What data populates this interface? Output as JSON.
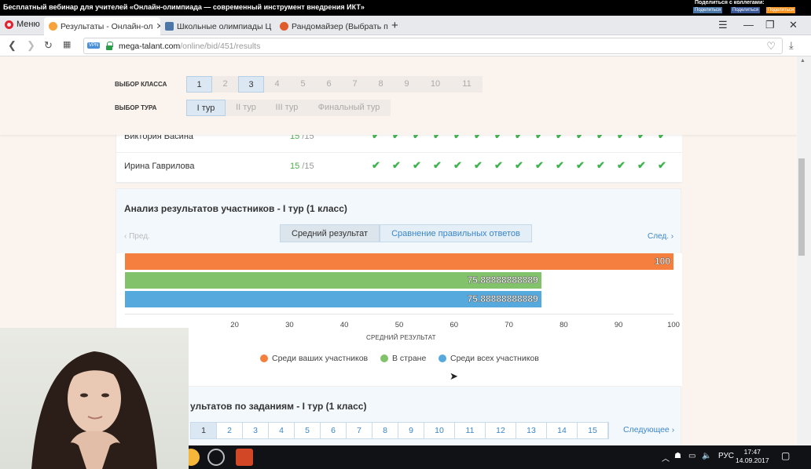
{
  "window": {
    "title": "Бесплатный вебинар для учителей «Онлайн-олимпиада — современный инструмент внедрения ИКТ»",
    "share_title": "Поделиться с коллегами:",
    "share_buttons": [
      "Поделиться",
      "Поделиться",
      "Поделиться"
    ]
  },
  "browser": {
    "menu_label": "Меню",
    "tabs": [
      {
        "label": "Результаты - Онлайн-ол",
        "active": true
      },
      {
        "label": "Школьные олимпиады Ц",
        "active": false
      },
      {
        "label": "Рандомайзер (Выбрать п",
        "active": false
      }
    ],
    "vpn_label": "VPN",
    "url_host": "mega-talant.com",
    "url_path": "/online/bid/451/results"
  },
  "filters": {
    "class_label": "ВЫБОР КЛАССА",
    "classes": [
      "1",
      "2",
      "3",
      "4",
      "5",
      "6",
      "7",
      "8",
      "9",
      "10",
      "11"
    ],
    "selected_class": "1",
    "tour_label": "ВЫБОР ТУРА",
    "tours": [
      "I тур",
      "II тур",
      "III тур",
      "Финальный тур"
    ],
    "selected_tour": "I тур"
  },
  "participants": [
    {
      "name": "Виктория Васина",
      "score": "15",
      "total": "/15",
      "checks": 15
    },
    {
      "name": "Ирина Гаврилова",
      "score": "15",
      "total": "/15",
      "checks": 15
    }
  ],
  "analysis": {
    "title": "Анализ результатов участников - I тур (1 класс)",
    "prev": "‹ Пред.",
    "next": "След. ›",
    "toggle": [
      "Средний результат",
      "Сравнение правильных ответов"
    ],
    "selected_toggle": "Средний результат"
  },
  "chart_data": {
    "type": "bar",
    "orientation": "horizontal",
    "series": [
      {
        "name": "Среди ваших участников",
        "value": 100,
        "label": "100",
        "color": "#f47f3f"
      },
      {
        "name": "В стране",
        "value": 75.88888888889,
        "label": "75.88888888889",
        "color": "#82c26a"
      },
      {
        "name": "Среди всех участников",
        "value": 75.88888888889,
        "label": "75.88888888889",
        "color": "#55a9dc"
      }
    ],
    "xlabel": "СРЕДНИЙ РЕЗУЛЬТАТ",
    "xlim": [
      0,
      100
    ],
    "ticks": [
      "20",
      "30",
      "40",
      "50",
      "60",
      "70",
      "80",
      "90",
      "100"
    ],
    "tick_values": [
      20,
      30,
      40,
      50,
      60,
      70,
      80,
      90,
      100
    ]
  },
  "tasks": {
    "title": "ультатов по заданиям - I тур (1 класс)",
    "pages": [
      "1",
      "2",
      "3",
      "4",
      "5",
      "6",
      "7",
      "8",
      "9",
      "10",
      "11",
      "12",
      "13",
      "14",
      "15"
    ],
    "selected_page": "1",
    "next": "Следующее ›"
  },
  "taskbar": {
    "lang": "РУС",
    "time": "17:47",
    "date": "14.09.2017"
  }
}
